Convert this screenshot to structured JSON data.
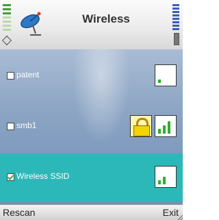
{
  "header": {
    "title": "Wireless"
  },
  "networks": [
    {
      "name": "patent",
      "checked": false,
      "secured": false,
      "signal_bars": 1
    },
    {
      "name": "smb1",
      "checked": false,
      "secured": true,
      "signal_bars": 3
    },
    {
      "name": "Wireless SSID",
      "checked": true,
      "secured": false,
      "signal_bars": 2,
      "selected": true
    }
  ],
  "softkeys": {
    "left": "Rescan",
    "right": "Exit"
  },
  "colors": {
    "selected_row": "#2cb8b8",
    "signal_bar": "#2bb030",
    "lock": "#f2d400"
  }
}
